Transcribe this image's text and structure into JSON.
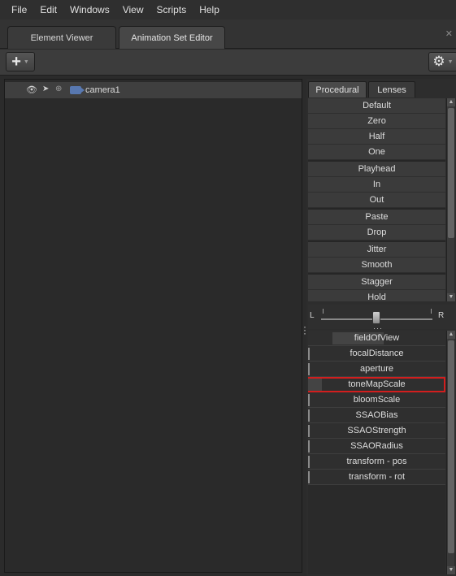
{
  "menu": [
    "File",
    "Edit",
    "Windows",
    "View",
    "Scripts",
    "Help"
  ],
  "tabs": {
    "element_viewer": "Element Viewer",
    "animation_set_editor": "Animation Set Editor"
  },
  "toolbar": {
    "add_icon": "plus-icon",
    "settings_icon": "gear-icon"
  },
  "tree": {
    "items": [
      {
        "label": "camera1",
        "icon": "camera-icon"
      }
    ]
  },
  "right_tabs": {
    "procedural": "Procedural",
    "lenses": "Lenses"
  },
  "procedural_groups": [
    [
      "Default",
      "Zero",
      "Half",
      "One"
    ],
    [
      "Playhead",
      "In",
      "Out"
    ],
    [
      "Paste",
      "Drop"
    ],
    [
      "Jitter",
      "Smooth"
    ],
    [
      "Stagger",
      "Hold"
    ]
  ],
  "slider": {
    "left_label": "L",
    "right_label": "R",
    "value": 0.5
  },
  "attributes": [
    {
      "label": "fieldOfView",
      "fill": 0.55
    },
    {
      "label": "focalDistance",
      "fill": 0.0
    },
    {
      "label": "aperture",
      "fill": 0.0
    },
    {
      "label": "toneMapScale",
      "fill": 0.1,
      "selected": true
    },
    {
      "label": "bloomScale",
      "fill": 0.0
    },
    {
      "label": "SSAOBias",
      "fill": 0.0
    },
    {
      "label": "SSAOStrength",
      "fill": 0.0
    },
    {
      "label": "SSAORadius",
      "fill": 0.0
    },
    {
      "label": "transform - pos",
      "fill": 0.0
    },
    {
      "label": "transform - rot",
      "fill": 0.0
    }
  ],
  "colors": {
    "selection_outline": "#d21e1e",
    "camera_icon": "#5878b0"
  }
}
